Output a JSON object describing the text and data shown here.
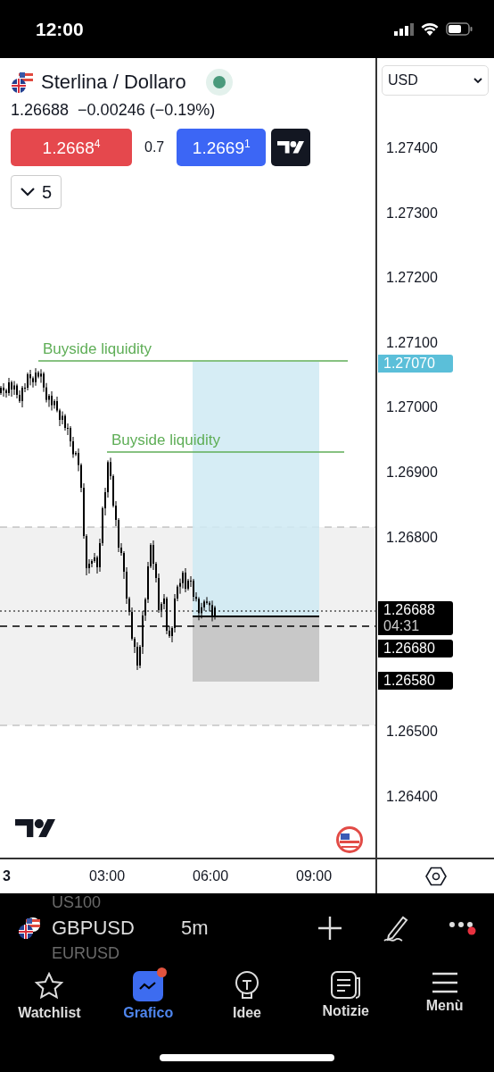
{
  "status_bar": {
    "time": "12:00"
  },
  "symbol": {
    "title": "Sterlina / Dollaro",
    "market_open": true,
    "price": "1.26688",
    "change": "−0.00246 (−0.19%)"
  },
  "trade": {
    "sell": "1.2668$^{4}$",
    "spread": "0.7",
    "buy": "1.2669$^{1}$"
  },
  "indicators": {
    "count": "5"
  },
  "drawings": [
    {
      "kind": "level",
      "label": "Buyside liquidity"
    },
    {
      "kind": "level",
      "label": "Buyside liquidity"
    }
  ],
  "price_axis": {
    "currency": "USD",
    "ticks": [
      "1.27400",
      "1.27300",
      "1.27200",
      "1.27100",
      "1.27000",
      "1.26900",
      "1.26800",
      "1.26500",
      "1.26400"
    ],
    "tags": [
      {
        "kind": "target",
        "label": "1.27070"
      },
      {
        "kind": "last",
        "label": "1.26688",
        "countdown": "04:31"
      },
      {
        "kind": "level",
        "label": "1.26680"
      },
      {
        "kind": "level",
        "label": "1.26580"
      }
    ]
  },
  "time_axis": {
    "labels": [
      "3",
      "03:00",
      "06:00",
      "09:00"
    ]
  },
  "toolbar": {
    "symbol": "GBPUSD",
    "interval": "5m",
    "faded_symbols": [
      "US100",
      "EURUSD"
    ],
    "menu_badge": true
  },
  "tabs": [
    {
      "label": "Watchlist",
      "selected": false,
      "badge": false
    },
    {
      "label": "Grafico",
      "selected": true,
      "badge": true
    },
    {
      "label": "Idee",
      "selected": false,
      "badge": false
    },
    {
      "label": "Notizie",
      "selected": false,
      "badge": false
    },
    {
      "label": "Menù",
      "selected": false,
      "badge": false
    }
  ]
}
